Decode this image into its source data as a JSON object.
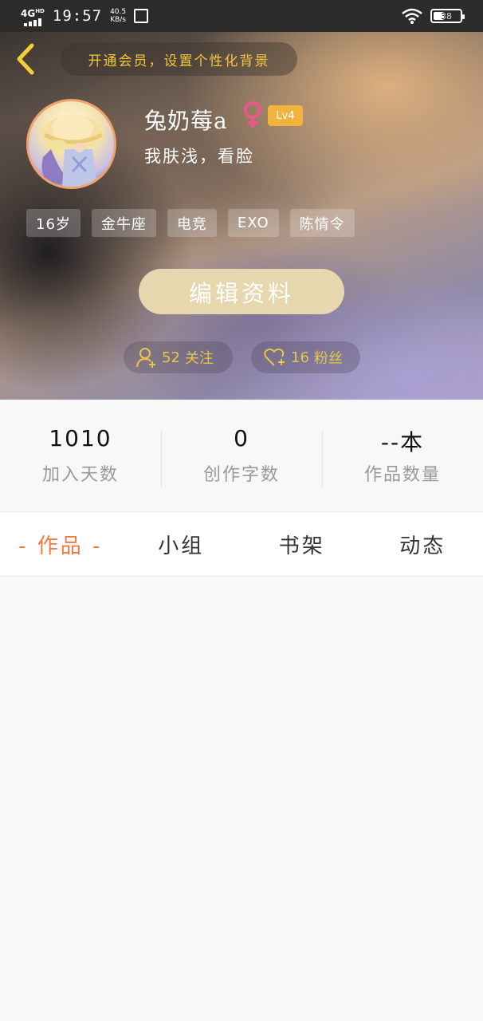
{
  "status_bar": {
    "network": "4G",
    "network_sup": "HD",
    "time": "19:57",
    "speed_value": "40.5",
    "speed_unit": "KB/s",
    "battery": "38"
  },
  "header": {
    "vip_banner": "开通会员，设置个性化背景"
  },
  "profile": {
    "username": "兔奶莓a",
    "gender": "female",
    "level": "Lv4",
    "signature": "我肤浅，看脸",
    "tags": [
      "16岁",
      "金牛座",
      "电竞",
      "EXO",
      "陈情令"
    ],
    "edit_button": "编辑资料",
    "following_count": "52",
    "following_label": "关注",
    "fans_count": "16",
    "fans_label": "粉丝"
  },
  "stats": [
    {
      "value": "1010",
      "label": "加入天数"
    },
    {
      "value": "0",
      "label": "创作字数"
    },
    {
      "value": "--本",
      "label": "作品数量"
    }
  ],
  "tabs": [
    {
      "label": "- 作品 -",
      "active": true
    },
    {
      "label": "小组",
      "active": false
    },
    {
      "label": "书架",
      "active": false
    },
    {
      "label": "动态",
      "active": false
    }
  ],
  "colors": {
    "accent_orange": "#f07b40",
    "gold": "#f3c93c",
    "edit_button": "#e6d7ae",
    "level_badge": "#f1b33c",
    "gender_pink": "#e8588a"
  }
}
